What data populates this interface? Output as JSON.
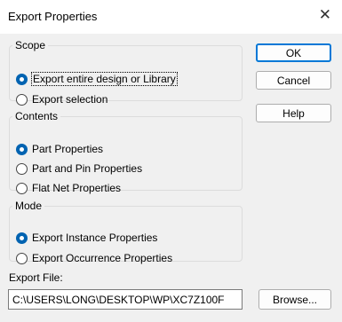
{
  "window": {
    "title": "Export Properties",
    "close_glyph": "✕",
    "close_icon": "close-icon"
  },
  "scope": {
    "legend": "Scope",
    "options": [
      "Export entire design or Library",
      "Export selection"
    ],
    "selected": "Export entire design or Library"
  },
  "contents": {
    "legend": "Contents",
    "options": [
      "Part Properties",
      "Part and Pin Properties",
      "Flat Net Properties"
    ],
    "selected": "Part Properties"
  },
  "mode": {
    "legend": "Mode",
    "options": [
      "Export Instance Properties",
      "Export Occurrence Properties"
    ],
    "selected": "Export Instance Properties"
  },
  "buttons": {
    "ok": "OK",
    "cancel": "Cancel",
    "help": "Help",
    "browse": "Browse..."
  },
  "export_file": {
    "label": "Export File:",
    "value": "C:\\USERS\\LONG\\DESKTOP\\WP\\XC7Z100F"
  },
  "colors": {
    "accent": "#0078d7",
    "radio_selected": "#0063b1",
    "background": "#f0f0f0",
    "titlebar": "#ffffff"
  }
}
